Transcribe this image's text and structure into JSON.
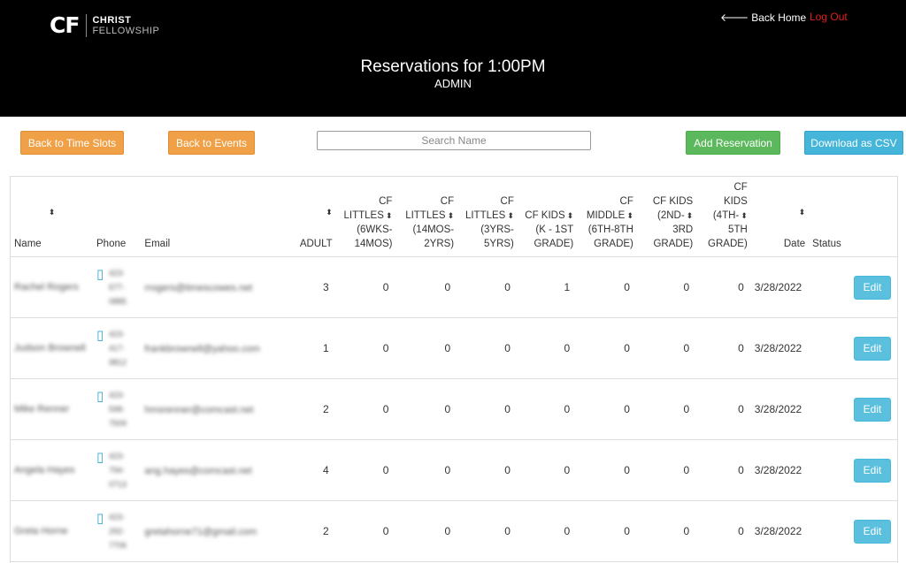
{
  "header": {
    "logo_mark": "CF",
    "logo_line1": "CHRIST",
    "logo_line2": "FELLOWSHIP",
    "back_home": "Back Home",
    "logout": "Log Out",
    "title": "Reservations for 1:00PM",
    "subtitle": "ADMIN"
  },
  "toolbar": {
    "back_time_slots": "Back to Time Slots",
    "back_events": "Back to Events",
    "search_placeholder": "Search Name",
    "add_reservation": "Add Reservation",
    "download_csv": "Download as CSV"
  },
  "colors": {
    "header_bg": "#000000",
    "orange": "#f0a046",
    "green": "#5cb85c",
    "blue": "#45b5da",
    "logout": "#e02020"
  },
  "table": {
    "columns": {
      "name": "Name",
      "phone": "Phone",
      "email": "Email",
      "adult": "ADULT",
      "littles1": [
        "CF",
        "LITTLES",
        "(6WKS-",
        "14MOS)"
      ],
      "littles2": [
        "CF",
        "LITTLES",
        "(14MOS-",
        "2YRS)"
      ],
      "littles3": [
        "CF",
        "LITTLES",
        "(3YRS-",
        "5YRS)"
      ],
      "kids1": [
        "CF KIDS",
        "(K - 1ST",
        "GRADE)"
      ],
      "middle": [
        "CF",
        "MIDDLE",
        "(6TH-8TH",
        "GRADE)"
      ],
      "kids2": [
        "CF KIDS",
        "(2ND-",
        "3RD",
        "GRADE)"
      ],
      "kids3": [
        "CF",
        "KIDS",
        "(4TH-",
        "5TH",
        "GRADE)"
      ],
      "date": "Date",
      "status": "Status"
    },
    "edit_label": "Edit",
    "rows": [
      {
        "name": "Rachel Rogers",
        "phone": [
          "423-",
          "677-",
          "0885"
        ],
        "email": "rrogers@timescowes.net",
        "adult": "3",
        "l1": "0",
        "l2": "0",
        "l3": "0",
        "k1": "1",
        "mid": "0",
        "k2": "0",
        "k3": "0",
        "date": "3/28/2022"
      },
      {
        "name": "Judson Brownell",
        "phone": [
          "423-",
          "417-",
          "9812"
        ],
        "email": "frankbrownell@yahoo.com",
        "adult": "1",
        "l1": "0",
        "l2": "0",
        "l3": "0",
        "k1": "0",
        "mid": "0",
        "k2": "0",
        "k3": "0",
        "date": "3/28/2022"
      },
      {
        "name": "Mike Renner",
        "phone": [
          "423-",
          "598-",
          "7509"
        ],
        "email": "hmsrenner@comcast.net",
        "adult": "2",
        "l1": "0",
        "l2": "0",
        "l3": "0",
        "k1": "0",
        "mid": "0",
        "k2": "0",
        "k3": "0",
        "date": "3/28/2022"
      },
      {
        "name": "Angela Hayes",
        "phone": [
          "423-",
          "794-",
          "0713"
        ],
        "email": "ang.hayes@comcast.net",
        "adult": "4",
        "l1": "0",
        "l2": "0",
        "l3": "0",
        "k1": "0",
        "mid": "0",
        "k2": "0",
        "k3": "0",
        "date": "3/28/2022"
      },
      {
        "name": "Greta Horne",
        "phone": [
          "423-",
          "292-",
          "7706"
        ],
        "email": "gretahorne71@gmail.com",
        "adult": "2",
        "l1": "0",
        "l2": "0",
        "l3": "0",
        "k1": "0",
        "mid": "0",
        "k2": "0",
        "k3": "0",
        "date": "3/28/2022"
      }
    ]
  }
}
